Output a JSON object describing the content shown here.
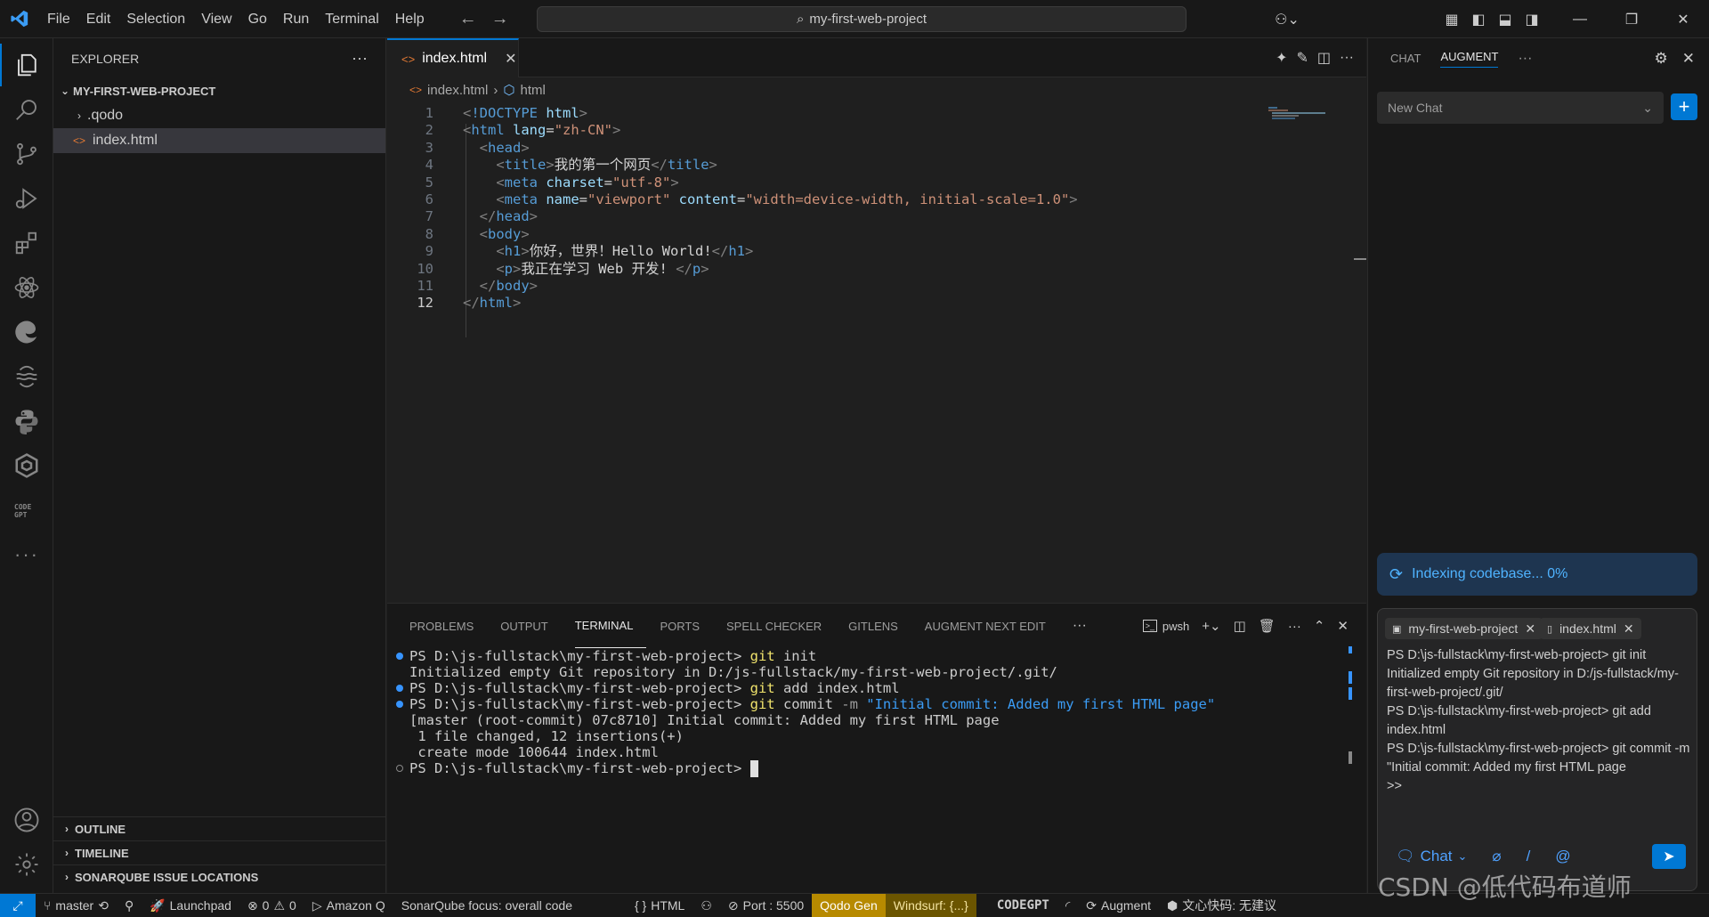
{
  "titlebar": {
    "menu": [
      "File",
      "Edit",
      "Selection",
      "View",
      "Go",
      "Run",
      "Terminal",
      "Help"
    ],
    "search_text": "my-first-web-project"
  },
  "sidebar": {
    "header": "EXPLORER",
    "project": "MY-FIRST-WEB-PROJECT",
    "items": [
      {
        "label": ".qodo",
        "type": "folder"
      },
      {
        "label": "index.html",
        "type": "file",
        "selected": true
      }
    ],
    "sections": [
      "OUTLINE",
      "TIMELINE",
      "SONARQUBE ISSUE LOCATIONS"
    ]
  },
  "editor": {
    "tab_label": "index.html",
    "breadcrumb": [
      "index.html",
      "html"
    ],
    "current_line": 12,
    "lines": [
      [
        {
          "c": "punct",
          "t": "<"
        },
        {
          "c": "tag",
          "t": "!DOCTYPE"
        },
        {
          "c": "attr",
          "t": " html"
        },
        {
          "c": "punct",
          "t": ">"
        }
      ],
      [
        {
          "c": "punct",
          "t": "<"
        },
        {
          "c": "tag",
          "t": "html"
        },
        {
          "c": "attr",
          "t": " lang"
        },
        {
          "c": "text",
          "t": "="
        },
        {
          "c": "str",
          "t": "\"zh-CN\""
        },
        {
          "c": "punct",
          "t": ">"
        }
      ],
      [
        {
          "c": "text",
          "t": "  "
        },
        {
          "c": "punct",
          "t": "<"
        },
        {
          "c": "tag",
          "t": "head"
        },
        {
          "c": "punct",
          "t": ">"
        }
      ],
      [
        {
          "c": "text",
          "t": "    "
        },
        {
          "c": "punct",
          "t": "<"
        },
        {
          "c": "tag",
          "t": "title"
        },
        {
          "c": "punct",
          "t": ">"
        },
        {
          "c": "text",
          "t": "我的第一个网页"
        },
        {
          "c": "punct",
          "t": "</"
        },
        {
          "c": "tag",
          "t": "title"
        },
        {
          "c": "punct",
          "t": ">"
        }
      ],
      [
        {
          "c": "text",
          "t": "    "
        },
        {
          "c": "punct",
          "t": "<"
        },
        {
          "c": "tag",
          "t": "meta"
        },
        {
          "c": "attr",
          "t": " charset"
        },
        {
          "c": "text",
          "t": "="
        },
        {
          "c": "str",
          "t": "\"utf-8\""
        },
        {
          "c": "punct",
          "t": ">"
        }
      ],
      [
        {
          "c": "text",
          "t": "    "
        },
        {
          "c": "punct",
          "t": "<"
        },
        {
          "c": "tag",
          "t": "meta"
        },
        {
          "c": "attr",
          "t": " name"
        },
        {
          "c": "text",
          "t": "="
        },
        {
          "c": "str",
          "t": "\"viewport\""
        },
        {
          "c": "attr",
          "t": " content"
        },
        {
          "c": "text",
          "t": "="
        },
        {
          "c": "str",
          "t": "\"width=device-width, initial-scale=1.0\""
        },
        {
          "c": "punct",
          "t": ">"
        }
      ],
      [
        {
          "c": "text",
          "t": "  "
        },
        {
          "c": "punct",
          "t": "</"
        },
        {
          "c": "tag",
          "t": "head"
        },
        {
          "c": "punct",
          "t": ">"
        }
      ],
      [
        {
          "c": "text",
          "t": "  "
        },
        {
          "c": "punct",
          "t": "<"
        },
        {
          "c": "tag",
          "t": "body"
        },
        {
          "c": "punct",
          "t": ">"
        }
      ],
      [
        {
          "c": "text",
          "t": "    "
        },
        {
          "c": "punct",
          "t": "<"
        },
        {
          "c": "tag",
          "t": "h1"
        },
        {
          "c": "punct",
          "t": ">"
        },
        {
          "c": "text",
          "t": "你好，世界！Hello World!"
        },
        {
          "c": "punct",
          "t": "</"
        },
        {
          "c": "tag",
          "t": "h1"
        },
        {
          "c": "punct",
          "t": ">"
        }
      ],
      [
        {
          "c": "text",
          "t": "    "
        },
        {
          "c": "punct",
          "t": "<"
        },
        {
          "c": "tag",
          "t": "p"
        },
        {
          "c": "punct",
          "t": ">"
        },
        {
          "c": "text",
          "t": "我正在学习 Web 开发! "
        },
        {
          "c": "punct",
          "t": "</"
        },
        {
          "c": "tag",
          "t": "p"
        },
        {
          "c": "punct",
          "t": ">"
        }
      ],
      [
        {
          "c": "text",
          "t": "  "
        },
        {
          "c": "punct",
          "t": "</"
        },
        {
          "c": "tag",
          "t": "body"
        },
        {
          "c": "punct",
          "t": ">"
        }
      ],
      [
        {
          "c": "punct",
          "t": "</"
        },
        {
          "c": "tag",
          "t": "html"
        },
        {
          "c": "punct",
          "t": ">"
        }
      ]
    ]
  },
  "panel": {
    "tabs": [
      "PROBLEMS",
      "OUTPUT",
      "TERMINAL",
      "PORTS",
      "SPELL CHECKER",
      "GITLENS",
      "AUGMENT NEXT EDIT"
    ],
    "active_tab": "TERMINAL",
    "shell": "pwsh",
    "terminal": [
      {
        "dot": "blue",
        "parts": [
          {
            "c": "plain",
            "t": "PS D:\\js-fullstack\\my-first-web-project> "
          },
          {
            "c": "cmd",
            "t": "git"
          },
          {
            "c": "plain",
            "t": " init"
          }
        ]
      },
      {
        "dot": "",
        "parts": [
          {
            "c": "plain",
            "t": "Initialized empty Git repository in D:/js-fullstack/my-first-web-project/.git/"
          }
        ]
      },
      {
        "dot": "blue",
        "parts": [
          {
            "c": "plain",
            "t": "PS D:\\js-fullstack\\my-first-web-project> "
          },
          {
            "c": "cmd",
            "t": "git"
          },
          {
            "c": "plain",
            "t": " add index.html"
          }
        ]
      },
      {
        "dot": "blue",
        "parts": [
          {
            "c": "plain",
            "t": "PS D:\\js-fullstack\\my-first-web-project> "
          },
          {
            "c": "cmd",
            "t": "git"
          },
          {
            "c": "plain",
            "t": " commit "
          },
          {
            "c": "flag",
            "t": "-m"
          },
          {
            "c": "arg",
            "t": " \"Initial commit: Added my first HTML page\""
          }
        ]
      },
      {
        "dot": "",
        "parts": [
          {
            "c": "plain",
            "t": "[master (root-commit) 07c8710] Initial commit: Added my first HTML page"
          }
        ]
      },
      {
        "dot": "",
        "parts": [
          {
            "c": "plain",
            "t": " 1 file changed, 12 insertions(+)"
          }
        ]
      },
      {
        "dot": "",
        "parts": [
          {
            "c": "plain",
            "t": " create mode 100644 index.html"
          }
        ]
      },
      {
        "dot": "hollow",
        "parts": [
          {
            "c": "plain",
            "t": "PS D:\\js-fullstack\\my-first-web-project> "
          }
        ],
        "cursor": true
      }
    ]
  },
  "augment": {
    "tabs": [
      "CHAT",
      "AUGMENT"
    ],
    "active_tab": "AUGMENT",
    "new_chat": "New Chat",
    "indexing": "Indexing codebase... 0%",
    "chips": [
      "my-first-web-project",
      "index.html"
    ],
    "input_text": "PS D:\\js-fullstack\\my-first-web-project> git init\nInitialized empty Git repository in D:/js-fullstack/my-first-web-project/.git/\nPS D:\\js-fullstack\\my-first-web-project> git add index.html\nPS D:\\js-fullstack\\my-first-web-project> git commit -m \"Initial commit: Added my first HTML page\n>>",
    "chat_mode": "Chat",
    "slash": "/",
    "at": "@"
  },
  "statusbar": {
    "branch": "master",
    "launchpad": "Launchpad",
    "errors": "0",
    "warnings": "0",
    "amazonq": "Amazon Q",
    "sonar": "SonarQube focus: overall code",
    "language": "HTML",
    "port": "Port : 5500",
    "qodo": "Qodo Gen",
    "windsurf": "Windsurf: {...}",
    "codegpt": "CODEGPT",
    "augment": "Augment",
    "wenxin": "文心快码: 无建议",
    "watermark": "CSDN @低代码布道师"
  }
}
